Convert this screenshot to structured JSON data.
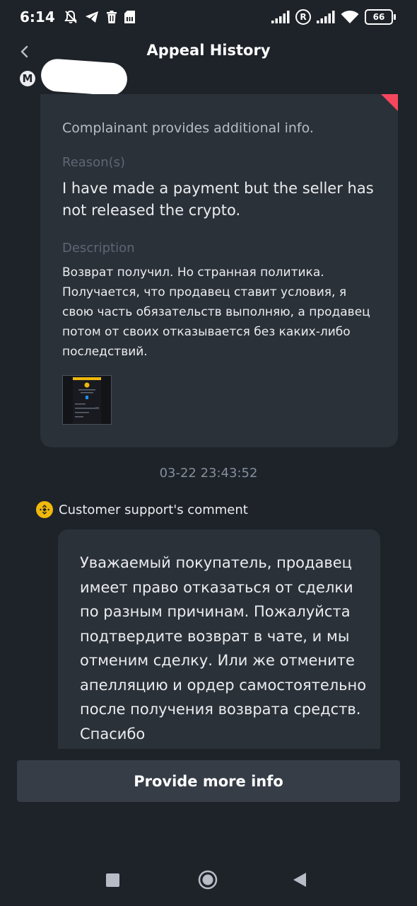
{
  "status_bar": {
    "time": "6:14",
    "r_indicator": "R",
    "battery": "66"
  },
  "header": {
    "title": "Appeal History"
  },
  "sender": {
    "avatar_letter": "M"
  },
  "complaint": {
    "heading": "Complainant provides additional info.",
    "reason_label": "Reason(s)",
    "reason": "I have made a payment but the seller has not released the crypto.",
    "description_label": "Description",
    "description": "Возврат получил. Но странная политика. Получается, что продавец ставит условия, я свою часть обязательств выполняю, а продавец потом от своих отказывается без каких-либо последствий."
  },
  "timestamp": "03-22 23:43:52",
  "support": {
    "label": "Customer support's comment",
    "comment": "Уважаемый покупатель, продавец имеет право отказаться от сделки по разным причинам. Пожалуйста подтвердите возврат в чате, и мы отменим сделку. Или же отмените апелляцию и ордер самостоятельно после получения возврата средств. Спасибо"
  },
  "actions": {
    "provide_more_info": "Provide more info"
  },
  "colors": {
    "background": "#1e2329",
    "card": "#2b3139",
    "accent": "#f0b90b",
    "flag": "#f6465d",
    "button": "#363d47"
  },
  "icons": {
    "back": "chevron-left-icon",
    "support": "binance-logo-icon",
    "status": [
      "notifications-off-icon",
      "telegram-icon",
      "trash-icon",
      "sd-card-icon",
      "signal-icon",
      "wifi-icon",
      "battery-icon"
    ],
    "nav": [
      "recents-square-icon",
      "home-circle-icon",
      "back-triangle-icon"
    ]
  }
}
